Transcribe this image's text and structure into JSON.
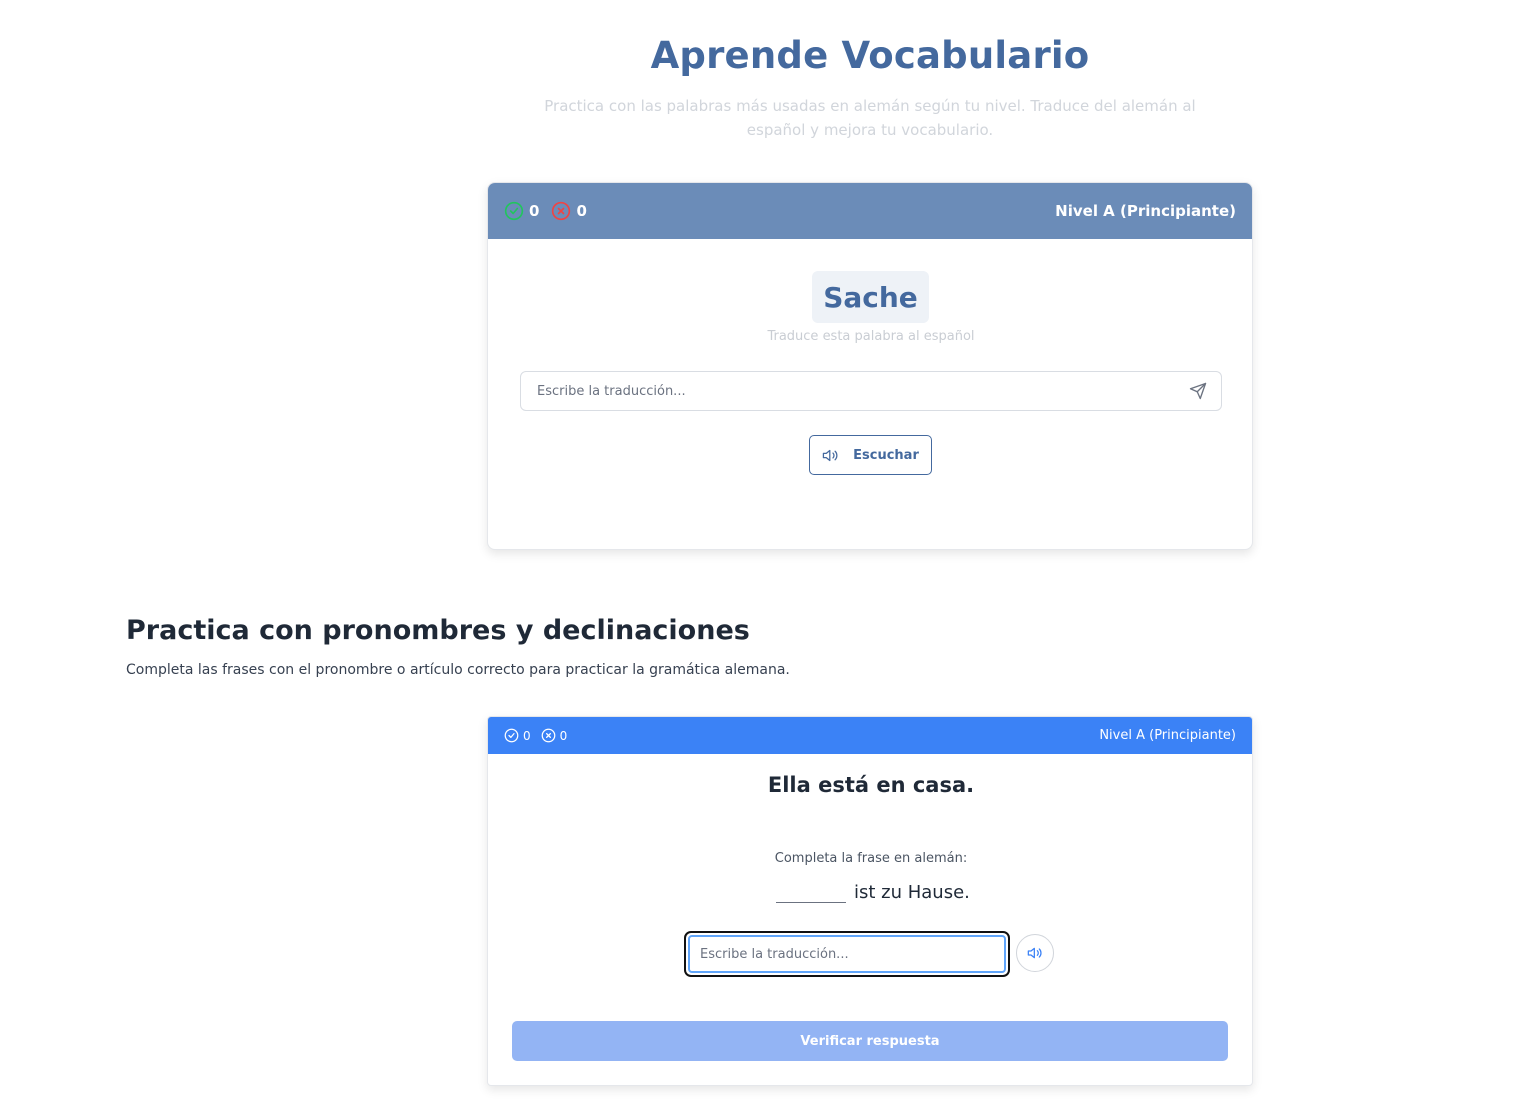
{
  "vocab": {
    "title": "Aprende Vocabulario",
    "subtitle": "Practica con las palabras más usadas en alemán según tu nivel. Traduce del alemán al español y mejora tu vocabulario.",
    "card": {
      "correct_count": "0",
      "wrong_count": "0",
      "level": "Nivel A (Principiante)",
      "word": "Sache",
      "hint": "Traduce esta palabra al español",
      "input_placeholder": "Escribe la traducción...",
      "listen_label": "Escuchar"
    }
  },
  "grammar": {
    "title": "Practica con pronombres y declinaciones",
    "subtitle": "Completa las frases con el pronombre o artículo correcto para practicar la gramática alemana.",
    "card": {
      "correct_count": "0",
      "wrong_count": "0",
      "level": "Nivel A (Principiante)",
      "sentence": "Ella está en casa.",
      "complete_label": "Completa la frase en alemán:",
      "phrase_rest": "ist zu Hause.",
      "input_placeholder": "Escribe la traducción...",
      "verify_label": "Verificar respuesta"
    }
  },
  "icons": {
    "correct": "check-circle-icon",
    "wrong": "x-circle-icon",
    "send": "send-icon",
    "speaker": "volume-icon"
  },
  "colors": {
    "primary": "#44699e",
    "card1_header": "#6b8cb8",
    "card2_header": "#3b82f6",
    "verify_button": "#93b4f4",
    "correct_icon": "#22c55e",
    "wrong_icon": "#ef4444"
  }
}
